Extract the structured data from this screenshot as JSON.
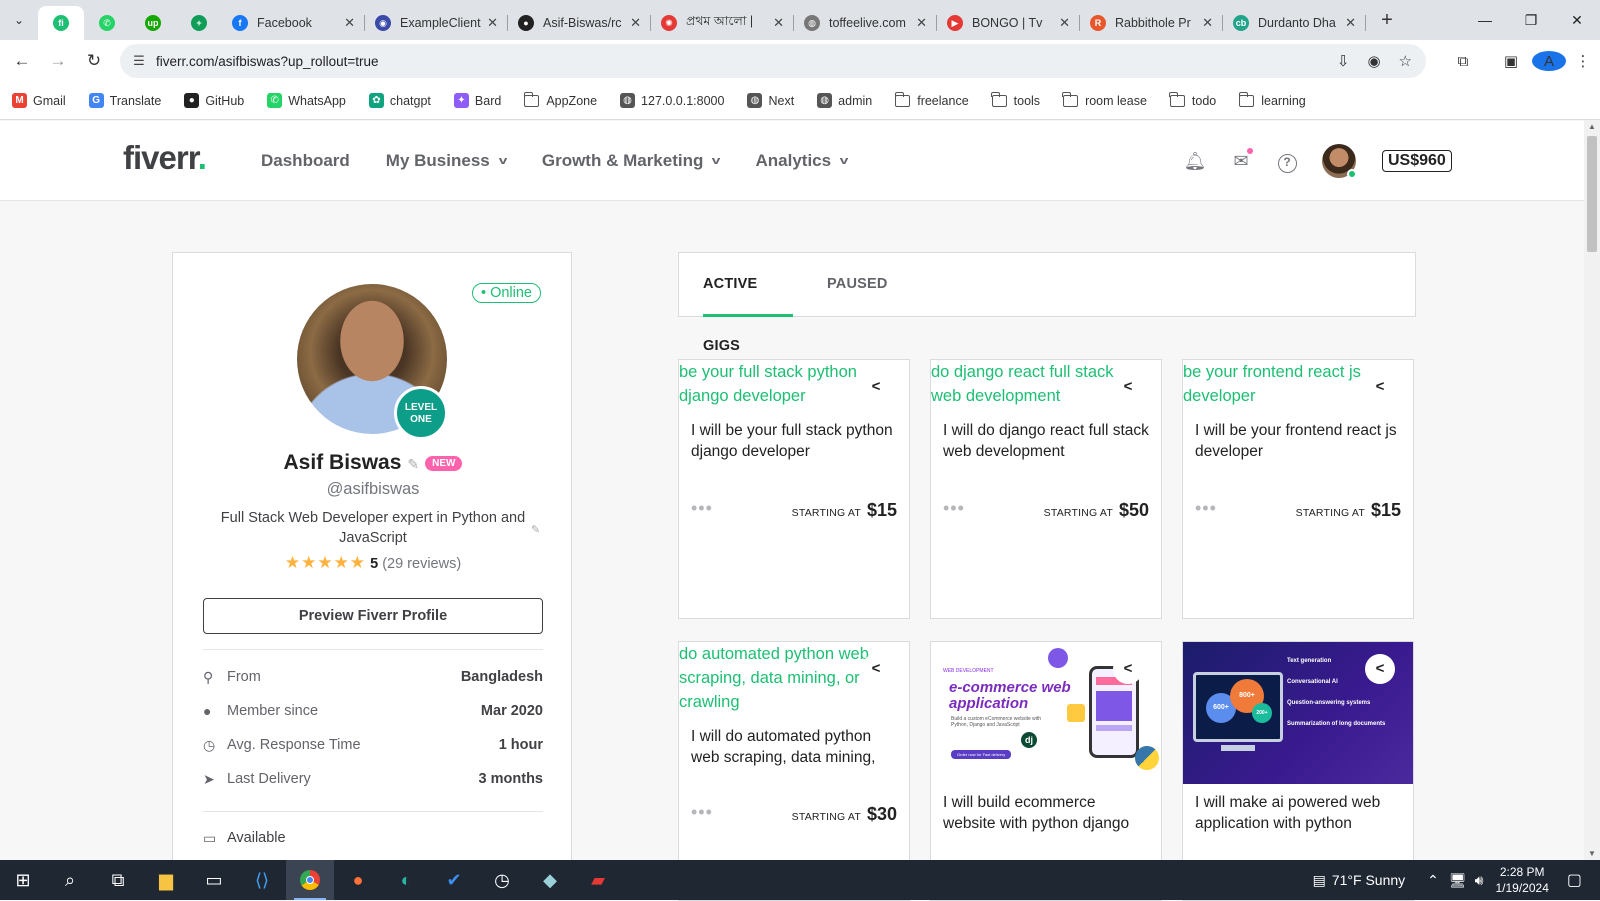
{
  "browser": {
    "tabs": [
      {
        "title": "",
        "favicon_color": "#1dbf73",
        "favicon_text": "fi",
        "pinned": true,
        "active": true
      },
      {
        "title": "",
        "favicon_color": "#25d366",
        "favicon_text": "✆",
        "pinned": true
      },
      {
        "title": "",
        "favicon_color": "#14a800",
        "favicon_text": "up",
        "pinned": true
      },
      {
        "title": "",
        "favicon_color": "#0f9d58",
        "favicon_text": "+",
        "pinned": true
      },
      {
        "title": "Facebook",
        "favicon_color": "#1877f2",
        "favicon_text": "f"
      },
      {
        "title": "ExampleClient",
        "favicon_color": "#3b4aa8",
        "favicon_text": "◉"
      },
      {
        "title": "Asif-Biswas/rc",
        "favicon_color": "#222222",
        "favicon_text": "●"
      },
      {
        "title": "প্রথম আলো | ",
        "favicon_color": "#e53935",
        "favicon_text": "✺"
      },
      {
        "title": "toffeelive.com",
        "favicon_color": "#777777",
        "favicon_text": "◍"
      },
      {
        "title": "BONGO | Tv",
        "favicon_color": "#e53935",
        "favicon_text": "▶"
      },
      {
        "title": "Rabbithole Pr",
        "favicon_color": "#e8562a",
        "favicon_text": "R"
      },
      {
        "title": "Durdanto Dha",
        "favicon_color": "#22a38a",
        "favicon_text": "cb"
      }
    ],
    "url": "fiverr.com/asifbiswas?up_rollout=true",
    "bookmarks": [
      {
        "label": "Gmail",
        "type": "icon",
        "color": "#ea4335",
        "glyph": "M"
      },
      {
        "label": "Translate",
        "type": "icon",
        "color": "#4285f4",
        "glyph": "G"
      },
      {
        "label": "GitHub",
        "type": "icon",
        "color": "#222222",
        "glyph": "●"
      },
      {
        "label": "WhatsApp",
        "type": "icon",
        "color": "#25d366",
        "glyph": "✆"
      },
      {
        "label": "chatgpt",
        "type": "icon",
        "color": "#10a37f",
        "glyph": "✿"
      },
      {
        "label": "Bard",
        "type": "icon",
        "color": "#8e5cf7",
        "glyph": "✦"
      },
      {
        "label": "AppZone",
        "type": "folder"
      },
      {
        "label": "127.0.0.1:8000",
        "type": "icon",
        "color": "#555555",
        "glyph": "◍"
      },
      {
        "label": "Next",
        "type": "icon",
        "color": "#555555",
        "glyph": "◍"
      },
      {
        "label": "admin",
        "type": "icon",
        "color": "#555555",
        "glyph": "◍"
      },
      {
        "label": "freelance",
        "type": "folder"
      },
      {
        "label": "tools",
        "type": "folder"
      },
      {
        "label": "room lease",
        "type": "folder"
      },
      {
        "label": "todo",
        "type": "folder"
      },
      {
        "label": "learning",
        "type": "folder"
      }
    ],
    "profile_initial": "A"
  },
  "fiverr": {
    "logo": "fiverr",
    "nav": [
      {
        "label": "Dashboard",
        "dropdown": false
      },
      {
        "label": "My Business",
        "dropdown": true
      },
      {
        "label": "Growth & Marketing",
        "dropdown": true
      },
      {
        "label": "Analytics",
        "dropdown": true
      }
    ],
    "balance": "US$960",
    "brand_color": "#1dbf73"
  },
  "profile": {
    "online_label": "• Online",
    "level_badge": "LEVEL ONE",
    "name": "Asif Biswas",
    "new_badge": "NEW",
    "username": "@asifbiswas",
    "description": "Full Stack Web Developer expert in Python and JavaScript",
    "stars": "★★★★★",
    "rating": "5",
    "reviews": "(29 reviews)",
    "preview_button": "Preview Fiverr Profile",
    "info": [
      {
        "label": "From",
        "value": "Bangladesh",
        "icon": "location-pin-icon"
      },
      {
        "label": "Member since",
        "value": "Mar 2020",
        "icon": "user-icon"
      },
      {
        "label": "Avg. Response Time",
        "value": "1 hour",
        "icon": "clock-icon"
      },
      {
        "label": "Last Delivery",
        "value": "3 months",
        "icon": "send-icon"
      }
    ],
    "availability": "Available"
  },
  "gig_tabs": {
    "active": "ACTIVE GIGS",
    "paused": "PAUSED"
  },
  "gigs": [
    {
      "alt": "be your full stack python django developer",
      "title": "I will be your full stack python django developer",
      "starting_at": "STARTING AT",
      "price": "$15"
    },
    {
      "alt": "do django react full stack web development",
      "title": "I will do django react full stack web development",
      "starting_at": "STARTING AT",
      "price": "$50"
    },
    {
      "alt": "be your frontend react js developer",
      "title": "I will be your frontend react js developer",
      "starting_at": "STARTING AT",
      "price": "$15"
    },
    {
      "alt": "do automated python web scraping, data mining, or crawling",
      "title": "I will do automated python web scraping, data mining,",
      "starting_at": "STARTING AT",
      "price": "$30"
    },
    {
      "title": "I will build ecommerce website with python django",
      "thumb_heading": "e-commerce web application",
      "thumb_tag": "WEB DEVELOPMENT",
      "thumb_sub": "Build a custom eCommerce website with Python, Django and JavaScript",
      "thumb_cta": "Order now for Fast delivery"
    },
    {
      "title": "I will make ai powered web application with python",
      "thumb_items": [
        "Text generation",
        "Conversational AI",
        "Question-answering systems",
        "Summarization of long documents"
      ],
      "thumb_nums": [
        "800+",
        "600+",
        "200+"
      ]
    }
  ],
  "taskbar": {
    "weather": "71°F  Sunny",
    "time": "2:28 PM",
    "date": "1/19/2024"
  }
}
